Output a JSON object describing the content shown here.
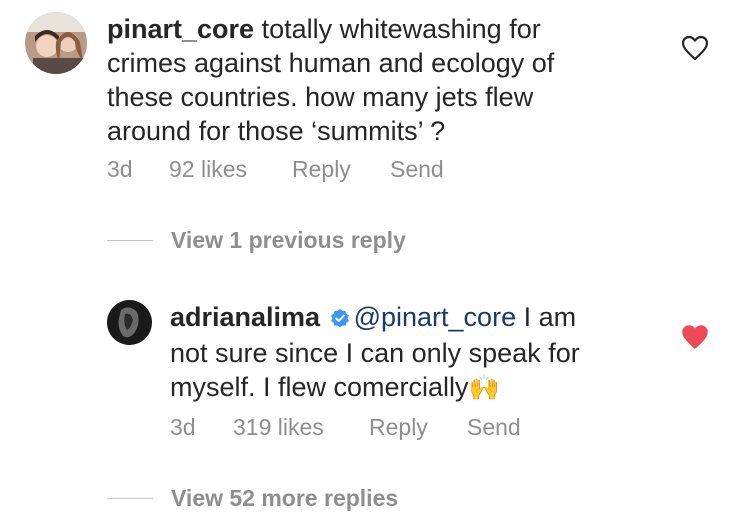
{
  "comment1": {
    "username": "pinart_core",
    "text_line1": " totally whitewashing for",
    "text_line2": "crimes against human and ecology of",
    "text_line3": "these countries. how many jets flew",
    "text_line4": "around for those ‘summits’ ?",
    "time": "3d",
    "likes": "92 likes",
    "reply": "Reply",
    "send": "Send",
    "liked": false
  },
  "view_previous": "View 1 previous reply",
  "reply1": {
    "username": "adrianalima",
    "verified": true,
    "mention": "@pinart_core",
    "text_line1": " I am",
    "text_line2": "not sure since I can only speak for",
    "text_line3": "myself. I flew comercially",
    "emoji": "🙌",
    "time": "3d",
    "likes": "319 likes",
    "reply": "Reply",
    "send": "Send",
    "liked": true
  },
  "view_more": "View 52 more replies",
  "colors": {
    "like_active": "#ed4956",
    "verified": "#3897f0",
    "mention": "#1b3b66"
  }
}
